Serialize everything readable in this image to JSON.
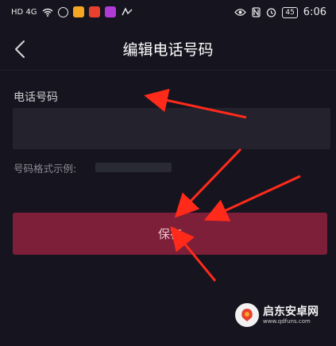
{
  "status_bar": {
    "network": "HD 4G",
    "battery": "45",
    "time": "6:06"
  },
  "header": {
    "title": "编辑电话号码",
    "back_icon": "chevron-left-icon"
  },
  "form": {
    "phone_label": "电话号码",
    "phone_value": "",
    "example_label": "号码格式示例:"
  },
  "actions": {
    "save_label": "保存"
  },
  "watermark": {
    "name": "启东安卓网",
    "url": "www.qdfuns.com"
  },
  "colors": {
    "background": "#16151f",
    "input_bg": "#23222d",
    "save_button": "#7e1f3a",
    "annotation_arrow": "#ff2a1a"
  }
}
